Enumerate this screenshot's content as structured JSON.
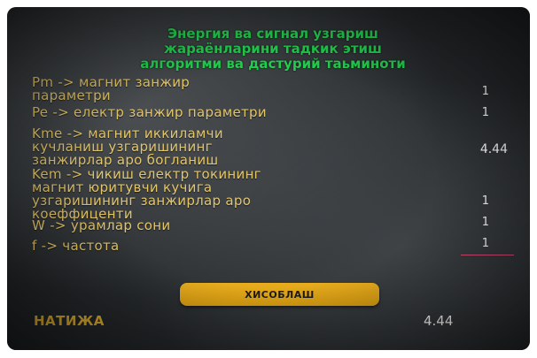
{
  "title": {
    "line1": "Энергия ва сигнал узгариш",
    "line2": "жараёнларини тадкик этиш",
    "line3": "алгоритми ва дастурий таьминоти"
  },
  "fields": [
    {
      "lines": [
        "Pm -> магнит занжир",
        "параметри"
      ],
      "value": "1"
    },
    {
      "lines": [
        "Pe -> електр занжир параметри"
      ],
      "value": "1"
    },
    {
      "lines": [
        "Kme ->  магнит иккиламчи",
        "кучланиш узгаришининг",
        "занжирлар аро богланиш"
      ],
      "value": "4.44"
    },
    {
      "lines": [
        "Kem -> чикиш електр токининг",
        "магнит юритувчи кучига",
        "узгаришининг занжирлар аро",
        "коеффиценти"
      ],
      "value": "1"
    },
    {
      "lines": [
        "W -> урамлар сони"
      ],
      "value": "1"
    },
    {
      "lines": [
        "f -> частота"
      ],
      "value": "1"
    }
  ],
  "button": {
    "label": "ХИСОБЛАШ"
  },
  "result": {
    "label": "НАТИЖА",
    "value": "4.44"
  },
  "colors": {
    "title": "#22d14f",
    "label": "#e4c66a",
    "button": "#e0a414",
    "active_underline": "#e0507a"
  }
}
